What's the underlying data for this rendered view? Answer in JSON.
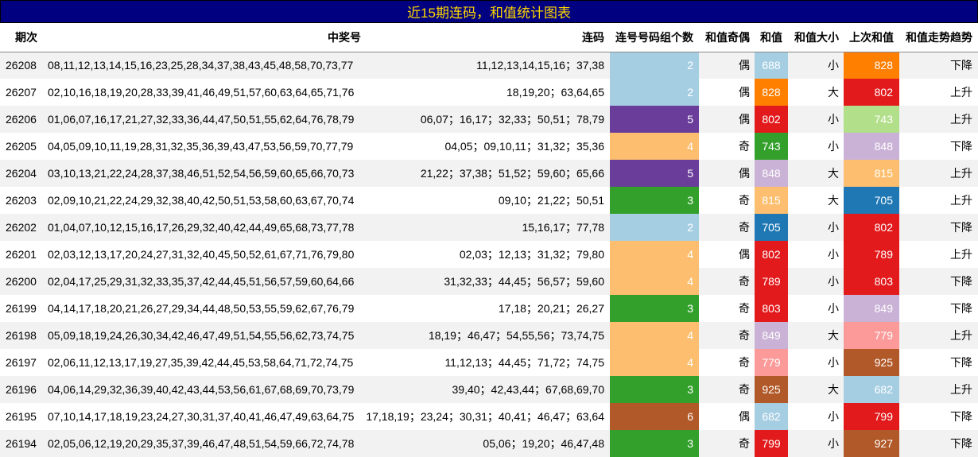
{
  "title": "近15期连码，和值统计图表",
  "headers": [
    "期次",
    "中奖号",
    "连码",
    "连号号码组个数",
    "和值奇偶",
    "和值",
    "和值大小",
    "上次和值",
    "和值走势趋势"
  ],
  "colors": {
    "1": "#a6cee3",
    "2": "#a6cee3",
    "3": "#33a02c",
    "4": "#fdbf6f",
    "5": "#6a3d9a",
    "6": "#b15928",
    "orange": "#ff7f00",
    "red": "#e31a1c",
    "lightgreen": "#b2df8a",
    "green": "#33a02c",
    "lavender": "#cab2d6",
    "peach": "#fdbf6f",
    "blue": "#1f78b4",
    "pink": "#fb9a99",
    "brown": "#b15928",
    "lightblue": "#a6cee3"
  },
  "rows": [
    {
      "period": "26208",
      "numbers": "08,11,12,13,14,15,16,23,25,28,34,37,38,43,45,48,58,70,73,77",
      "consec": "11,12,13,14,15,16；37,38",
      "count": "2",
      "count_color": "#a6cee3",
      "parity": "偶",
      "sum": "688",
      "sum_color": "#a6cee3",
      "size": "小",
      "prev": "828",
      "prev_color": "#ff7f00",
      "trend": "下降"
    },
    {
      "period": "26207",
      "numbers": "02,10,16,18,19,20,28,33,39,41,46,49,51,57,60,63,64,65,71,76",
      "consec": "18,19,20；63,64,65",
      "count": "2",
      "count_color": "#a6cee3",
      "parity": "偶",
      "sum": "828",
      "sum_color": "#ff7f00",
      "size": "大",
      "prev": "802",
      "prev_color": "#e31a1c",
      "trend": "上升"
    },
    {
      "period": "26206",
      "numbers": "01,06,07,16,17,21,27,32,33,36,44,47,50,51,55,62,64,76,78,79",
      "consec": "06,07；16,17；32,33；50,51；78,79",
      "count": "5",
      "count_color": "#6a3d9a",
      "parity": "偶",
      "sum": "802",
      "sum_color": "#e31a1c",
      "size": "小",
      "prev": "743",
      "prev_color": "#b2df8a",
      "trend": "上升"
    },
    {
      "period": "26205",
      "numbers": "04,05,09,10,11,19,28,31,32,35,36,39,43,47,53,56,59,70,77,79",
      "consec": "04,05；09,10,11；31,32；35,36",
      "count": "4",
      "count_color": "#fdbf6f",
      "parity": "奇",
      "sum": "743",
      "sum_color": "#33a02c",
      "size": "小",
      "prev": "848",
      "prev_color": "#cab2d6",
      "trend": "下降"
    },
    {
      "period": "26204",
      "numbers": "03,10,13,21,22,24,28,37,38,46,51,52,54,56,59,60,65,66,70,73",
      "consec": "21,22；37,38；51,52；59,60；65,66",
      "count": "5",
      "count_color": "#6a3d9a",
      "parity": "偶",
      "sum": "848",
      "sum_color": "#cab2d6",
      "size": "大",
      "prev": "815",
      "prev_color": "#fdbf6f",
      "trend": "上升"
    },
    {
      "period": "26203",
      "numbers": "02,09,10,21,22,24,29,32,38,40,42,50,51,53,58,60,63,67,70,74",
      "consec": "09,10；21,22；50,51",
      "count": "3",
      "count_color": "#33a02c",
      "parity": "奇",
      "sum": "815",
      "sum_color": "#fdbf6f",
      "size": "大",
      "prev": "705",
      "prev_color": "#1f78b4",
      "trend": "上升"
    },
    {
      "period": "26202",
      "numbers": "01,04,07,10,12,15,16,17,26,29,32,40,42,44,49,65,68,73,77,78",
      "consec": "15,16,17；77,78",
      "count": "2",
      "count_color": "#a6cee3",
      "parity": "奇",
      "sum": "705",
      "sum_color": "#1f78b4",
      "size": "小",
      "prev": "802",
      "prev_color": "#e31a1c",
      "trend": "下降"
    },
    {
      "period": "26201",
      "numbers": "02,03,12,13,17,20,24,27,31,32,40,45,50,52,61,67,71,76,79,80",
      "consec": "02,03；12,13；31,32；79,80",
      "count": "4",
      "count_color": "#fdbf6f",
      "parity": "偶",
      "sum": "802",
      "sum_color": "#e31a1c",
      "size": "小",
      "prev": "789",
      "prev_color": "#e31a1c",
      "trend": "上升"
    },
    {
      "period": "26200",
      "numbers": "02,04,17,25,29,31,32,33,35,37,42,44,45,51,56,57,59,60,64,66",
      "consec": "31,32,33；44,45；56,57；59,60",
      "count": "4",
      "count_color": "#fdbf6f",
      "parity": "奇",
      "sum": "789",
      "sum_color": "#e31a1c",
      "size": "小",
      "prev": "803",
      "prev_color": "#e31a1c",
      "trend": "下降"
    },
    {
      "period": "26199",
      "numbers": "04,14,17,18,20,21,26,27,29,34,44,48,50,53,55,59,62,67,76,79",
      "consec": "17,18；20,21；26,27",
      "count": "3",
      "count_color": "#33a02c",
      "parity": "奇",
      "sum": "803",
      "sum_color": "#e31a1c",
      "size": "小",
      "prev": "849",
      "prev_color": "#cab2d6",
      "trend": "下降"
    },
    {
      "period": "26198",
      "numbers": "05,09,18,19,24,26,30,34,42,46,47,49,51,54,55,56,62,73,74,75",
      "consec": "18,19；46,47；54,55,56；73,74,75",
      "count": "4",
      "count_color": "#fdbf6f",
      "parity": "奇",
      "sum": "849",
      "sum_color": "#cab2d6",
      "size": "大",
      "prev": "779",
      "prev_color": "#fb9a99",
      "trend": "上升"
    },
    {
      "period": "26197",
      "numbers": "02,06,11,12,13,17,19,27,35,39,42,44,45,53,58,64,71,72,74,75",
      "consec": "11,12,13；44,45；71,72；74,75",
      "count": "4",
      "count_color": "#fdbf6f",
      "parity": "奇",
      "sum": "779",
      "sum_color": "#fb9a99",
      "size": "小",
      "prev": "925",
      "prev_color": "#b15928",
      "trend": "下降"
    },
    {
      "period": "26196",
      "numbers": "04,06,14,29,32,36,39,40,42,43,44,53,56,61,67,68,69,70,73,79",
      "consec": "39,40；42,43,44；67,68,69,70",
      "count": "3",
      "count_color": "#33a02c",
      "parity": "奇",
      "sum": "925",
      "sum_color": "#b15928",
      "size": "大",
      "prev": "682",
      "prev_color": "#a6cee3",
      "trend": "上升"
    },
    {
      "period": "26195",
      "numbers": "07,10,14,17,18,19,23,24,27,30,31,37,40,41,46,47,49,63,64,75",
      "consec": "17,18,19；23,24；30,31；40,41；46,47；63,64",
      "count": "6",
      "count_color": "#b15928",
      "parity": "偶",
      "sum": "682",
      "sum_color": "#a6cee3",
      "size": "小",
      "prev": "799",
      "prev_color": "#e31a1c",
      "trend": "下降"
    },
    {
      "period": "26194",
      "numbers": "02,05,06,12,19,20,29,35,37,39,46,47,48,51,54,59,66,72,74,78",
      "consec": "05,06；19,20；46,47,48",
      "count": "3",
      "count_color": "#33a02c",
      "parity": "奇",
      "sum": "799",
      "sum_color": "#e31a1c",
      "size": "小",
      "prev": "927",
      "prev_color": "#b15928",
      "trend": "下降"
    }
  ]
}
